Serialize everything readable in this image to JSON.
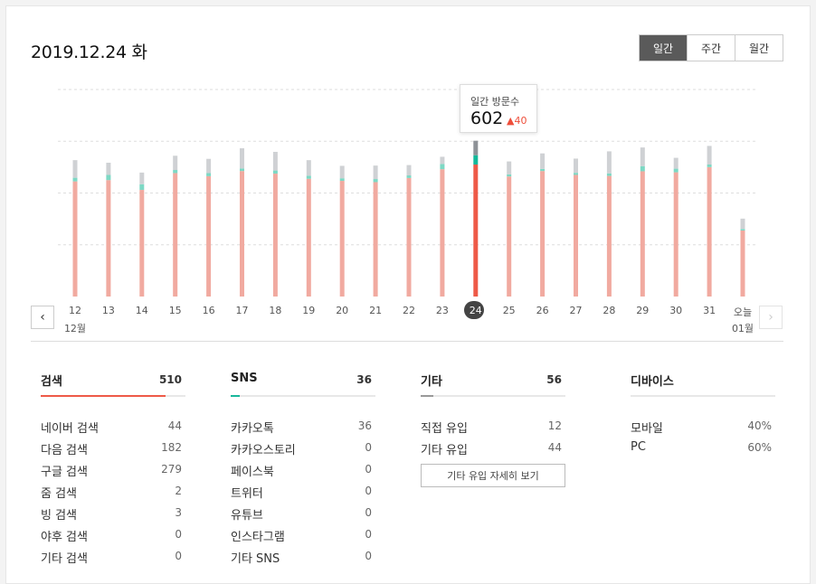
{
  "header": {
    "date_title": "2019.12.24 화",
    "tabs": [
      "일간",
      "주간",
      "월간"
    ],
    "active_tab": 0
  },
  "tooltip": {
    "title": "일간 방문수",
    "value": "602",
    "delta": "40"
  },
  "colors": {
    "search": "#f1aaa0",
    "search_selected": "#ee5a48",
    "sns": "#7dd8c4",
    "sns_selected": "#14b89a",
    "other": "#cfd1d4",
    "other_selected": "#8e9297",
    "accent_search": "#ee5a48",
    "accent_sns": "#19b79b",
    "accent_other": "#999999"
  },
  "nav": {
    "prev_icon": "chevron-left-icon",
    "next_icon": "chevron-right-icon"
  },
  "chart_data": {
    "type": "bar",
    "stacked": true,
    "categories": [
      "12",
      "13",
      "14",
      "15",
      "16",
      "17",
      "18",
      "19",
      "20",
      "21",
      "22",
      "23",
      "24",
      "25",
      "26",
      "27",
      "28",
      "29",
      "30",
      "31",
      "오늘"
    ],
    "month_labels": [
      {
        "index": 0,
        "label": "12월"
      },
      {
        "index": 20,
        "label": "01월"
      }
    ],
    "selected_index": 12,
    "series": [
      {
        "name": "검색",
        "values": [
          445,
          450,
          412,
          477,
          465,
          485,
          475,
          455,
          447,
          442,
          458,
          492,
          510,
          464,
          485,
          470,
          466,
          484,
          480,
          500,
          255
        ]
      },
      {
        "name": "SNS",
        "values": [
          14,
          20,
          22,
          12,
          12,
          10,
          12,
          12,
          10,
          12,
          10,
          20,
          36,
          8,
          8,
          8,
          10,
          20,
          14,
          10,
          6
        ]
      },
      {
        "name": "기타",
        "values": [
          68,
          47,
          45,
          55,
          55,
          78,
          72,
          60,
          48,
          52,
          40,
          28,
          56,
          50,
          60,
          55,
          85,
          72,
          42,
          72,
          40
        ]
      }
    ],
    "ylim": [
      0,
      800
    ],
    "grid": true,
    "gridlines": [
      200,
      400,
      600,
      800
    ]
  },
  "sections": [
    {
      "name": "검색",
      "count": "510",
      "share": 0.86,
      "color_key": "accent_search",
      "rows": [
        {
          "label": "네이버 검색",
          "value": "44"
        },
        {
          "label": "다음 검색",
          "value": "182"
        },
        {
          "label": "구글 검색",
          "value": "279"
        },
        {
          "label": "줌 검색",
          "value": "2"
        },
        {
          "label": "빙 검색",
          "value": "3"
        },
        {
          "label": "야후 검색",
          "value": "0"
        },
        {
          "label": "기타 검색",
          "value": "0"
        }
      ]
    },
    {
      "name": "SNS",
      "count": "36",
      "share": 0.06,
      "color_key": "accent_sns",
      "rows": [
        {
          "label": "카카오톡",
          "value": "36"
        },
        {
          "label": "카카오스토리",
          "value": "0"
        },
        {
          "label": "페이스북",
          "value": "0"
        },
        {
          "label": "트위터",
          "value": "0"
        },
        {
          "label": "유튜브",
          "value": "0"
        },
        {
          "label": "인스타그램",
          "value": "0"
        },
        {
          "label": "기타 SNS",
          "value": "0"
        }
      ]
    },
    {
      "name": "기타",
      "count": "56",
      "share": 0.09,
      "color_key": "accent_other",
      "rows": [
        {
          "label": "직접 유입",
          "value": "12"
        },
        {
          "label": "기타 유입",
          "value": "44"
        }
      ],
      "button": "기타 유입 자세히 보기"
    },
    {
      "name": "디바이스",
      "count": "",
      "share": 0,
      "color_key": "accent_other",
      "rows": [
        {
          "label": "모바일",
          "value": "40%"
        },
        {
          "label": "PC",
          "value": "60%"
        }
      ]
    }
  ]
}
